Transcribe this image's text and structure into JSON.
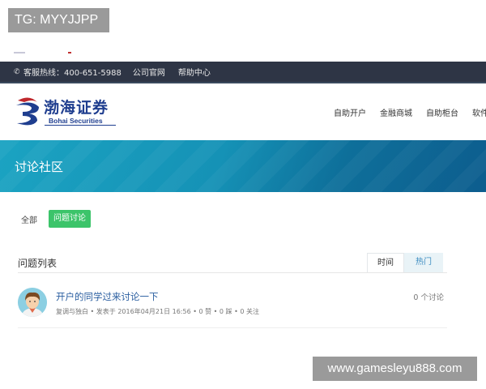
{
  "watermarks": {
    "top": "TG: MYYJJPP",
    "bottom": "www.gamesleyu888.com"
  },
  "topbar": {
    "hotline": "客服热线：400-651-5988",
    "links": [
      "公司官网",
      "帮助中心"
    ]
  },
  "logo": {
    "name_cn": "渤海证券",
    "name_en": "Bohai Securities"
  },
  "nav": [
    "自助开户",
    "金融商城",
    "自助柜台",
    "软件"
  ],
  "banner": {
    "title": "讨论社区"
  },
  "filters": {
    "all": "全部",
    "active": "问题讨论"
  },
  "list": {
    "title": "问题列表",
    "tabs": [
      "时间",
      "热门"
    ]
  },
  "questions": [
    {
      "title": "开户的同学过来讨论一下",
      "meta": "复调与独白 • 发表于 2016年04月21日 16:56 • 0 赞 • 0 踩 • 0 关注",
      "discussions": "0 个讨论"
    }
  ],
  "colors": {
    "topbar_bg": "#2e3545",
    "banner_accent": "#1592b6",
    "active_chip": "#3cc46a",
    "link_blue": "#2a5ea0",
    "brand_blue": "#1f3e8f"
  }
}
